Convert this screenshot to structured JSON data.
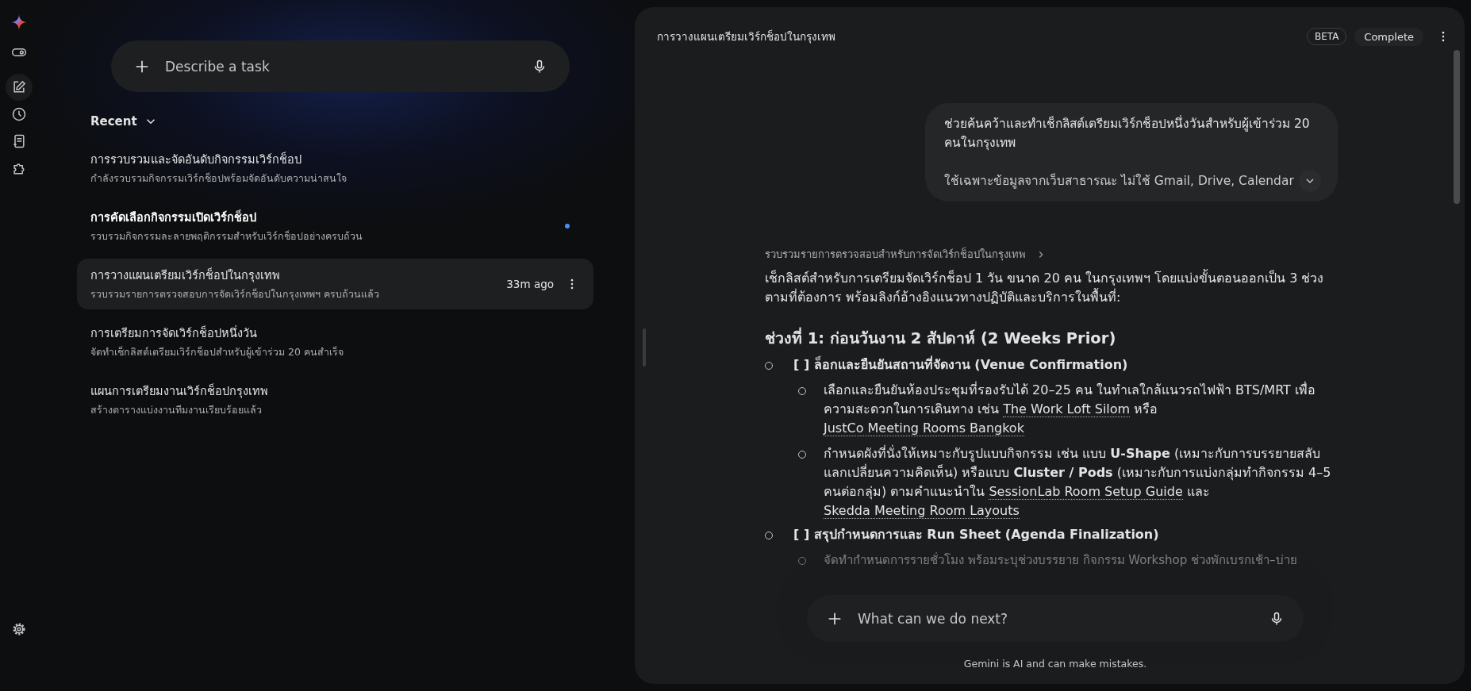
{
  "rail": {
    "items": [
      {
        "selected": false
      },
      {
        "selected": true
      },
      {
        "selected": false
      },
      {
        "selected": false
      },
      {
        "selected": false
      }
    ]
  },
  "search": {
    "placeholder": "Describe a task"
  },
  "recent": {
    "label": "Recent",
    "expanded": true
  },
  "tasks": [
    {
      "title": "การรวบรวมและจัดอันดับกิจกรรมเวิร์กช็อป",
      "subtitle": "กำลังรวบรวมกิจกรรมเวิร์กช็อปพร้อมจัดอันดับความน่าสนใจ",
      "selected": false,
      "unread": false
    },
    {
      "title": "การคัดเลือกกิจกรรมเปิดเวิร์กช็อป",
      "subtitle": "รวบรวมกิจกรรมละลายพฤติกรรมสำหรับเวิร์กช็อปอย่างครบถ้วน",
      "selected": false,
      "unread": true
    },
    {
      "title": "การวางแผนเตรียมเวิร์กช็อปในกรุงเทพ",
      "subtitle": "รวบรวมรายการตรวจสอบการจัดเวิร์กช็อปในกรุงเทพฯ ครบถ้วนแล้ว",
      "selected": true,
      "unread": false,
      "time": "33m ago"
    },
    {
      "title": "การเตรียมการจัดเวิร์กช็อปหนึ่งวัน",
      "subtitle": "จัดทำเช็กลิสต์เตรียมเวิร์กช็อปสำหรับผู้เข้าร่วม 20 คนสำเร็จ",
      "selected": false,
      "unread": false
    },
    {
      "title": "แผนการเตรียมงานเวิร์กช็อปกรุงเทพ",
      "subtitle": "สร้างตารางแบ่งงานทีมงานเรียบร้อยแล้ว",
      "selected": false,
      "unread": false
    }
  ],
  "panel": {
    "title": "การวางแผนเตรียมเวิร์กช็อปในกรุงเทพ",
    "badge": "BETA",
    "status": "Complete",
    "user_message": {
      "paragraphs": [
        "ช่วยค้นคว้าและทำเช็กลิสต์เตรียมเวิร์กช็อปหนึ่งวันสำหรับผู้เข้าร่วม 20 คนในกรุงเทพ",
        "ใช้เฉพาะข้อมูลจากเว็บสาธารณะ ไม่ใช้ Gmail, Drive, Calendar"
      ],
      "expanded": false
    },
    "breadcrumb": "รวบรวมรายการตรวจสอบสำหรับการจัดเวิร์กช็อปในกรุงเทพ",
    "intro": "เช็กลิสต์สำหรับการเตรียมจัดเวิร์กช็อป 1 วัน ขนาด 20 คน ในกรุงเทพฯ โดยแบ่งขั้นตอนออกเป็น 3 ช่วงตามที่ต้องการ พร้อมลิงก์อ้างอิงแนวทางปฏิบัติและบริการในพื้นที่:",
    "heading": "ช่วงที่ 1: ก่อนวันงาน 2 สัปดาห์ (2 Weeks Prior)",
    "items": [
      {
        "title": "[ ] ล็อกและยืนยันสถานที่จัดงาน (Venue Confirmation)",
        "children": [
          {
            "segments": [
              {
                "kind": "text",
                "text": "เลือกและยืนยันห้องประชุมที่รองรับได้ 20–25 คน ในทำเลใกล้แนวรถไฟฟ้า BTS/MRT เพื่อความสะดวกในการเดินทาง เช่น "
              },
              {
                "kind": "link",
                "text": "The Work Loft Silom"
              },
              {
                "kind": "text",
                "text": " หรือ "
              },
              {
                "kind": "link",
                "text": "JustCo Meeting Rooms Bangkok"
              }
            ]
          },
          {
            "segments": [
              {
                "kind": "text",
                "text": "กำหนดผังที่นั่งให้เหมาะกับรูปแบบกิจกรรม เช่น แบบ **U-Shape** (เหมาะกับการบรรยายสลับแลกเปลี่ยนความคิดเห็น) หรือแบบ **Cluster / Pods** (เหมาะกับการแบ่งกลุ่มทำกิจกรรม 4–5 คนต่อกลุ่ม) ตามคำแนะนำใน "
              },
              {
                "kind": "link",
                "text": "SessionLab Room Setup Guide"
              },
              {
                "kind": "text",
                "text": " และ "
              },
              {
                "kind": "link",
                "text": "Skedda Meeting Room Layouts"
              }
            ]
          }
        ]
      },
      {
        "title": "[ ] สรุปกำหนดการและ Run Sheet (Agenda Finalization)",
        "children": [
          {
            "segments": [
              {
                "kind": "text",
                "text": "จัดทำกำหนดการรายชั่วโมง พร้อมระบุช่วงบรรยาย กิจกรรม Workshop ช่วงพักเบรกเช้า–บ่าย"
              }
            ]
          }
        ]
      }
    ],
    "composer": {
      "placeholder": "What can we do next?"
    },
    "disclaimer": "Gemini is AI and can make mistakes."
  }
}
